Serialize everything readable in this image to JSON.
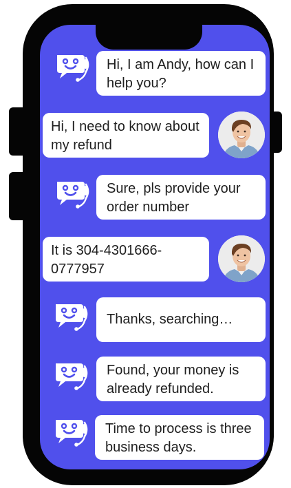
{
  "colors": {
    "screen": "#5050ec",
    "frame": "#050505",
    "bubble": "#ffffff",
    "text": "#1f1f1f"
  },
  "icons": {
    "bot": "chatbot-icon",
    "user": "user-avatar"
  },
  "messages": [
    {
      "from": "bot",
      "text": "Hi, I am Andy, how can I help you?"
    },
    {
      "from": "user",
      "text": "Hi, I need to know about my refund"
    },
    {
      "from": "bot",
      "text": "Sure, pls provide your order number"
    },
    {
      "from": "user",
      "text": "It is 304-4301666-0777957"
    },
    {
      "from": "bot",
      "text": "Thanks, searching…"
    },
    {
      "from": "bot",
      "text": "Found, your money is already refunded."
    },
    {
      "from": "bot",
      "text": "Time to process is three business days."
    }
  ]
}
